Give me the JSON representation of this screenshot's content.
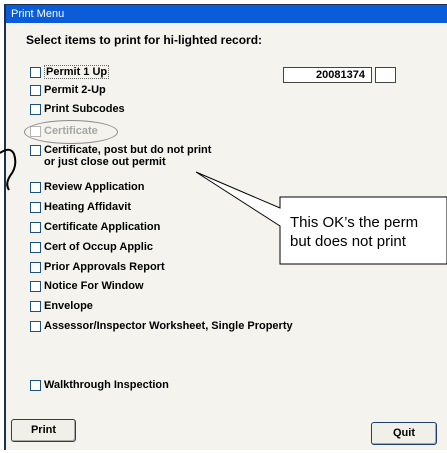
{
  "window": {
    "title": "Print Menu"
  },
  "instruction": "Select items to print for hi-lighted record:",
  "options": [
    {
      "label": "Permit 1 Up",
      "checked": false,
      "enabled": true
    },
    {
      "label": "Permit 2-Up",
      "checked": false,
      "enabled": true
    },
    {
      "label": "Print Subcodes",
      "checked": false,
      "enabled": true
    },
    {
      "label": "Certificate",
      "checked": false,
      "enabled": false
    },
    {
      "label_line1": "Certificate, post but do not print",
      "label_line2": "or just close out permit",
      "checked": false,
      "enabled": true
    },
    {
      "label": "Review Application",
      "checked": false,
      "enabled": true
    },
    {
      "label": "Heating Affidavit",
      "checked": false,
      "enabled": true
    },
    {
      "label": "Certificate Application",
      "checked": false,
      "enabled": true
    },
    {
      "label": "Cert of Occup Applic",
      "checked": false,
      "enabled": true
    },
    {
      "label": "Prior Approvals Report",
      "checked": false,
      "enabled": true
    },
    {
      "label": "Notice For Window",
      "checked": false,
      "enabled": true
    },
    {
      "label": "Envelope",
      "checked": false,
      "enabled": true
    },
    {
      "label": "Assessor/Inspector Worksheet, Single Property",
      "checked": false,
      "enabled": true
    },
    {
      "label": "Walkthrough Inspection",
      "checked": false,
      "enabled": true
    }
  ],
  "permit_number": {
    "value": "20081374"
  },
  "extra_field": {
    "value": ""
  },
  "buttons": {
    "print": "Print",
    "quit": "Quit"
  },
  "callout": {
    "line1": "This OK’s the perm",
    "line2": "but does not print"
  },
  "colors": {
    "titlebar": "#0a5cd8",
    "window_bg": "#f4f3ee",
    "disabled_text": "#a6a6a6"
  }
}
